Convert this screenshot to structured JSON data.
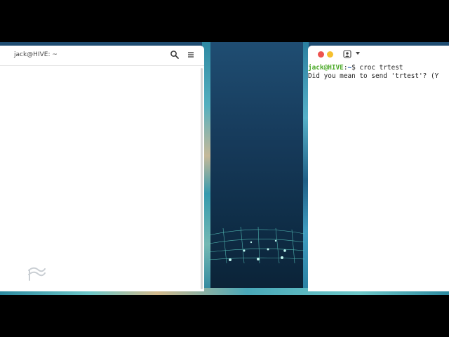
{
  "file_window": {
    "title": "jack@HIVE: ~",
    "icons": {
      "search": "search-icon",
      "menu": "hamburger-menu-icon",
      "logo": "app-logo-icon"
    }
  },
  "terminal": {
    "icons": {
      "person": "person-icon",
      "dropdown": "chevron-down-icon"
    },
    "prompt_user": "jack@HIVE",
    "prompt_sep": ":",
    "prompt_path": "~",
    "prompt_end": "$ ",
    "command": "croc trtest",
    "output_line": "Did you mean to send 'trtest'? (Y"
  },
  "colors": {
    "close_button": "#ed5350",
    "minimize_button": "#f5c02f",
    "prompt_user": "#4caa29",
    "prompt_path": "#2a5fb0"
  }
}
